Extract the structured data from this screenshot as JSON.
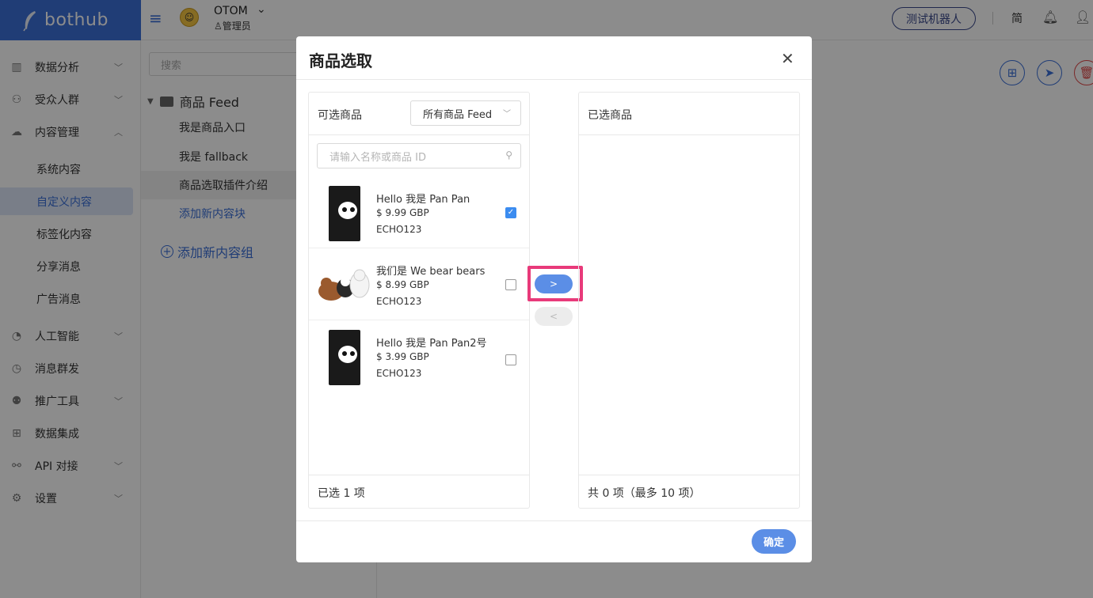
{
  "topbar": {
    "logo_text": "bothub",
    "org_name": "OTOM",
    "org_role": "管理员",
    "test_bot_label": "测试机器人",
    "lang_label": "简"
  },
  "sidebar": {
    "items": [
      {
        "label": "数据分析",
        "icon": "chart-icon"
      },
      {
        "label": "受众人群",
        "icon": "users-icon"
      },
      {
        "label": "内容管理",
        "icon": "content-icon"
      },
      {
        "label": "系统内容"
      },
      {
        "label": "自定义内容"
      },
      {
        "label": "标签化内容"
      },
      {
        "label": "分享消息"
      },
      {
        "label": "广告消息"
      },
      {
        "label": "人工智能",
        "icon": "ai-icon"
      },
      {
        "label": "消息群发",
        "icon": "broadcast-icon"
      },
      {
        "label": "推广工具",
        "icon": "promo-icon"
      },
      {
        "label": "数据集成",
        "icon": "integration-icon"
      },
      {
        "label": "API 对接",
        "icon": "api-icon"
      },
      {
        "label": "设置",
        "icon": "settings-icon"
      }
    ]
  },
  "content_tree": {
    "search_placeholder": "搜索",
    "root_label": "商品 Feed",
    "items": [
      "我是商品入口",
      "我是 fallback",
      "商品选取插件介绍",
      "添加新内容块"
    ],
    "add_group_label": "添加新内容组"
  },
  "modal": {
    "title": "商品选取",
    "left_panel": {
      "title": "可选商品",
      "feed_select_value": "所有商品 Feed",
      "search_placeholder": "请输入名称或商品 ID",
      "footer_text": "已选 1 项",
      "products": [
        {
          "name": "Hello 我是 Pan Pan",
          "price": "$ 9.99 GBP",
          "sku": "ECHO123",
          "checked": true
        },
        {
          "name": "我们是 We bear bears",
          "price": "$ 8.99 GBP",
          "sku": "ECHO123",
          "checked": false
        },
        {
          "name": "Hello 我是 Pan Pan2号",
          "price": "$ 3.99 GBP",
          "sku": "ECHO123",
          "checked": false
        }
      ]
    },
    "right_panel": {
      "title": "已选商品",
      "footer_text": "共 0 项（最多 10 项）"
    },
    "move_right_label": ">",
    "move_left_label": "<",
    "confirm_label": "确定"
  }
}
